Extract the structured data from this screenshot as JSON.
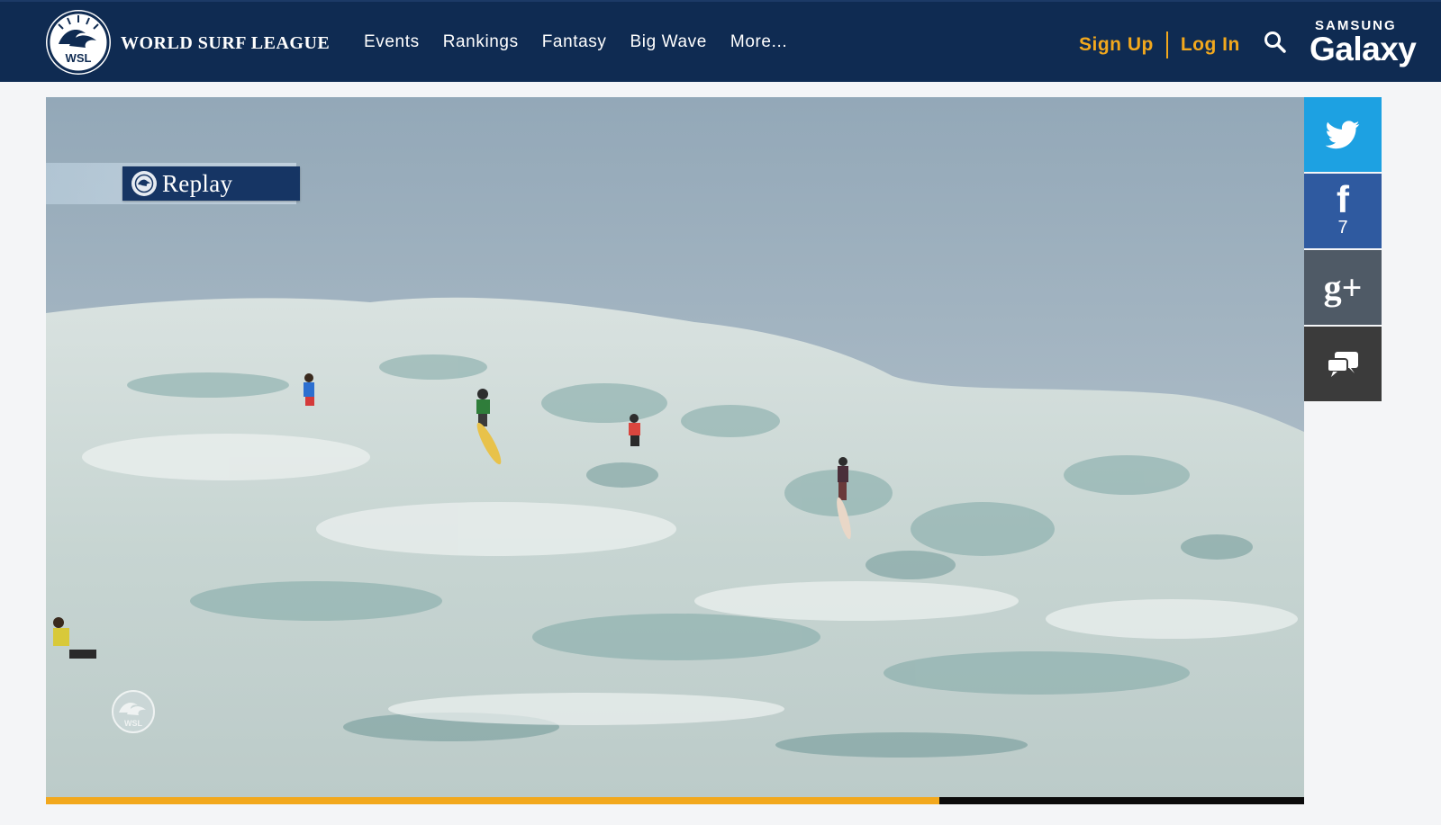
{
  "header": {
    "logo_text": "WSL",
    "brand": "WORLD SURF LEAGUE",
    "nav": [
      "Events",
      "Rankings",
      "Fantasy",
      "Big Wave",
      "More..."
    ],
    "sign_up": "Sign Up",
    "log_in": "Log In",
    "search_icon": "search-icon",
    "sponsor_top": "SAMSUNG",
    "sponsor_main": "Galaxy"
  },
  "video": {
    "overlay_label": "Replay",
    "watermark_text": "WSL",
    "progress_fraction": 0.71
  },
  "share": {
    "twitter_icon": "twitter-icon",
    "facebook_icon": "f",
    "facebook_count": "7",
    "googleplus_icon": "g+",
    "comment_icon": "comment-icon"
  },
  "colors": {
    "header_bg": "#0f2b52",
    "accent": "#f2a81d",
    "twitter": "#1da1e2",
    "facebook": "#2f5aa0",
    "googleplus": "#4f5a66",
    "comments": "#3b3b3b"
  }
}
